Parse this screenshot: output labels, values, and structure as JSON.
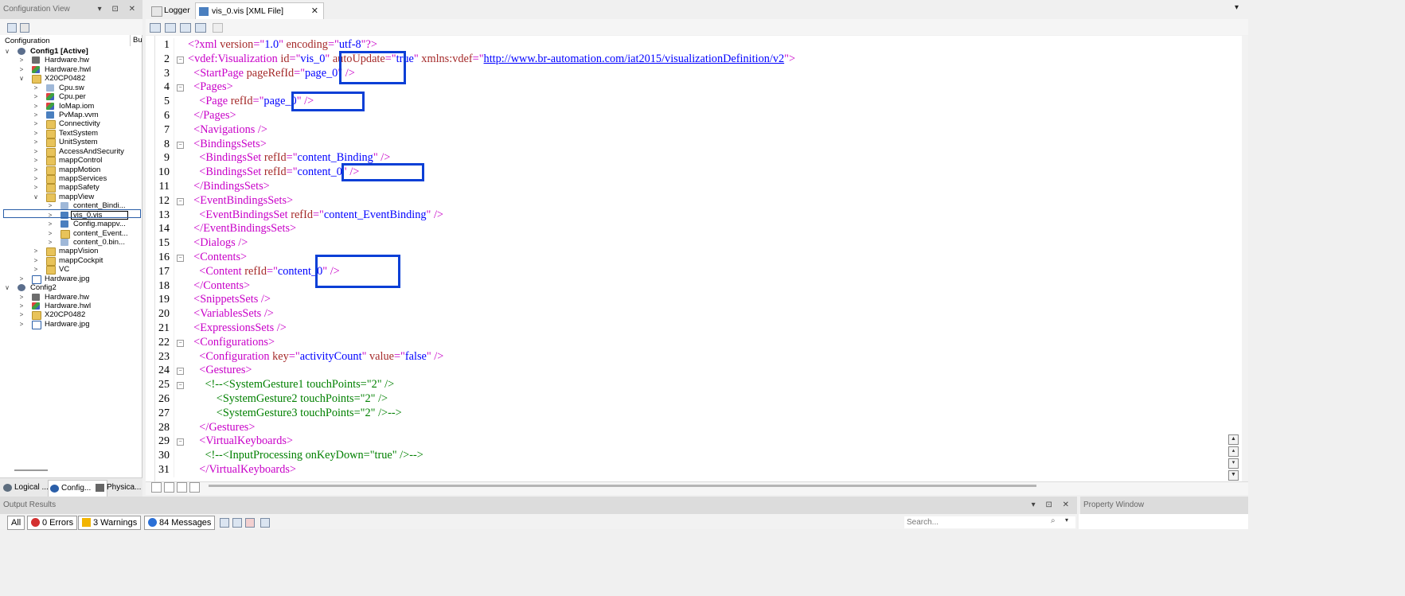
{
  "left_panel": {
    "title": "Configuration View",
    "title_buttons": "▾ ⊡ ✕",
    "column_header": "Configuration",
    "column_header_2": "Bu",
    "tree": [
      {
        "label": "Config1 [Active]",
        "bold": true,
        "indent": 0,
        "chev": "∨",
        "icon": "gear"
      },
      {
        "label": "Hardware.hw",
        "indent": 1,
        "chev": ">",
        "icon": "hw"
      },
      {
        "label": "Hardware.hwl",
        "indent": 1,
        "chev": ">",
        "icon": "multi"
      },
      {
        "label": "X20CP0482",
        "indent": 1,
        "chev": "∨",
        "icon": "folder"
      },
      {
        "label": "Cpu.sw",
        "indent": 2,
        "chev": ">",
        "icon": "doc"
      },
      {
        "label": "Cpu.per",
        "indent": 2,
        "chev": ">",
        "icon": "multi"
      },
      {
        "label": "IoMap.iom",
        "indent": 2,
        "chev": ">",
        "icon": "multi"
      },
      {
        "label": "PvMap.vvm",
        "indent": 2,
        "chev": ">",
        "icon": "cpu"
      },
      {
        "label": "Connectivity",
        "indent": 2,
        "chev": ">",
        "icon": "folder"
      },
      {
        "label": "TextSystem",
        "indent": 2,
        "chev": ">",
        "icon": "folder"
      },
      {
        "label": "UnitSystem",
        "indent": 2,
        "chev": ">",
        "icon": "folder"
      },
      {
        "label": "AccessAndSecurity",
        "indent": 2,
        "chev": ">",
        "icon": "folder"
      },
      {
        "label": "mappControl",
        "indent": 2,
        "chev": ">",
        "icon": "folder"
      },
      {
        "label": "mappMotion",
        "indent": 2,
        "chev": ">",
        "icon": "folder"
      },
      {
        "label": "mappServices",
        "indent": 2,
        "chev": ">",
        "icon": "folder"
      },
      {
        "label": "mappSafety",
        "indent": 2,
        "chev": ">",
        "icon": "folder"
      },
      {
        "label": "mappView",
        "indent": 2,
        "chev": "∨",
        "icon": "folder"
      },
      {
        "label": "content_Bindi...",
        "indent": 3,
        "chev": ">",
        "icon": "doc"
      },
      {
        "label": "vis_0.vis",
        "indent": 3,
        "chev": ">",
        "icon": "cpu",
        "editing": true
      },
      {
        "label": "Config.mappv...",
        "indent": 3,
        "chev": ">",
        "icon": "cpu"
      },
      {
        "label": "content_Event...",
        "indent": 3,
        "chev": ">",
        "icon": "folder"
      },
      {
        "label": "content_0.bin...",
        "indent": 3,
        "chev": ">",
        "icon": "doc"
      },
      {
        "label": "mappVision",
        "indent": 2,
        "chev": ">",
        "icon": "folder"
      },
      {
        "label": "mappCockpit",
        "indent": 2,
        "chev": ">",
        "icon": "folder"
      },
      {
        "label": "VC",
        "indent": 2,
        "chev": ">",
        "icon": "folder"
      },
      {
        "label": "Hardware.jpg",
        "indent": 1,
        "chev": ">",
        "icon": "img"
      },
      {
        "label": "Config2",
        "indent": 0,
        "chev": "∨",
        "icon": "gear"
      },
      {
        "label": "Hardware.hw",
        "indent": 1,
        "chev": ">",
        "icon": "hw"
      },
      {
        "label": "Hardware.hwl",
        "indent": 1,
        "chev": ">",
        "icon": "multi"
      },
      {
        "label": "X20CP0482",
        "indent": 1,
        "chev": ">",
        "icon": "folder"
      },
      {
        "label": "Hardware.jpg",
        "indent": 1,
        "chev": ">",
        "icon": "img"
      }
    ],
    "tabs": [
      "Logical ...",
      "Config...",
      "Physica..."
    ]
  },
  "tabs": {
    "logger": "Logger",
    "active": "vis_0.vis [XML File]",
    "close": "✕",
    "menu": "▾"
  },
  "editor": {
    "line_numbers": [
      "1",
      "2",
      "3",
      "4",
      "5",
      "6",
      "7",
      "8",
      "9",
      "10",
      "11",
      "12",
      "13",
      "14",
      "15",
      "16",
      "17",
      "18",
      "19",
      "20",
      "21",
      "22",
      "23",
      "24",
      "25",
      "26",
      "27",
      "28",
      "29",
      "30",
      "31"
    ],
    "lines": [
      [
        [
          "tag",
          "<?xml "
        ],
        [
          "attr",
          "version"
        ],
        [
          "tag",
          "=\""
        ],
        [
          "val",
          "1.0"
        ],
        [
          "tag",
          "\" "
        ],
        [
          "attr",
          "encoding"
        ],
        [
          "tag",
          "=\""
        ],
        [
          "val",
          "utf-8"
        ],
        [
          "tag",
          "\"?>"
        ]
      ],
      [
        [
          "tag",
          "<vdef:Visualization "
        ],
        [
          "attr",
          "id"
        ],
        [
          "tag",
          "=\""
        ],
        [
          "val",
          "vis_0"
        ],
        [
          "tag",
          "\" "
        ],
        [
          "attr",
          "autoUpdate"
        ],
        [
          "tag",
          "=\""
        ],
        [
          "val",
          "true"
        ],
        [
          "tag",
          "\" "
        ],
        [
          "attr",
          "xmlns:vdef"
        ],
        [
          "tag",
          "=\""
        ],
        [
          "url",
          "http://www.br-automation.com/iat2015/visualizationDefinition/v2"
        ],
        [
          "tag",
          "\">"
        ]
      ],
      [
        [
          "plain",
          "  "
        ],
        [
          "tag",
          "<StartPage "
        ],
        [
          "attr",
          "pageRefId"
        ],
        [
          "tag",
          "=\""
        ],
        [
          "val",
          "page_0"
        ],
        [
          "tag",
          "\" />"
        ]
      ],
      [
        [
          "plain",
          "  "
        ],
        [
          "tag",
          "<Pages>"
        ]
      ],
      [
        [
          "plain",
          "    "
        ],
        [
          "tag",
          "<Page "
        ],
        [
          "attr",
          "refId"
        ],
        [
          "tag",
          "=\""
        ],
        [
          "val",
          "page_0"
        ],
        [
          "tag",
          "\" />"
        ]
      ],
      [
        [
          "plain",
          "  "
        ],
        [
          "tag",
          "</Pages>"
        ]
      ],
      [
        [
          "plain",
          "  "
        ],
        [
          "tag",
          "<Navigations />"
        ]
      ],
      [
        [
          "plain",
          "  "
        ],
        [
          "tag",
          "<BindingsSets>"
        ]
      ],
      [
        [
          "plain",
          "    "
        ],
        [
          "tag",
          "<BindingsSet "
        ],
        [
          "attr",
          "refId"
        ],
        [
          "tag",
          "=\""
        ],
        [
          "val",
          "content_Binding"
        ],
        [
          "tag",
          "\" />"
        ]
      ],
      [
        [
          "plain",
          "    "
        ],
        [
          "tag",
          "<BindingsSet "
        ],
        [
          "attr",
          "refId"
        ],
        [
          "tag",
          "=\""
        ],
        [
          "val",
          "content_0"
        ],
        [
          "tag",
          "\" />"
        ]
      ],
      [
        [
          "plain",
          "  "
        ],
        [
          "tag",
          "</BindingsSets>"
        ]
      ],
      [
        [
          "plain",
          "  "
        ],
        [
          "tag",
          "<EventBindingsSets>"
        ]
      ],
      [
        [
          "plain",
          "    "
        ],
        [
          "tag",
          "<EventBindingsSet "
        ],
        [
          "attr",
          "refId"
        ],
        [
          "tag",
          "=\""
        ],
        [
          "val",
          "content_EventBinding"
        ],
        [
          "tag",
          "\" />"
        ]
      ],
      [
        [
          "plain",
          "  "
        ],
        [
          "tag",
          "</EventBindingsSets>"
        ]
      ],
      [
        [
          "plain",
          "  "
        ],
        [
          "tag",
          "<Dialogs />"
        ]
      ],
      [
        [
          "plain",
          "  "
        ],
        [
          "tag",
          "<Contents>"
        ]
      ],
      [
        [
          "plain",
          "    "
        ],
        [
          "tag",
          "<Content "
        ],
        [
          "attr",
          "refId"
        ],
        [
          "tag",
          "=\""
        ],
        [
          "val",
          "content_0"
        ],
        [
          "tag",
          "\" />"
        ]
      ],
      [
        [
          "plain",
          "  "
        ],
        [
          "tag",
          "</Contents>"
        ]
      ],
      [
        [
          "plain",
          "  "
        ],
        [
          "tag",
          "<SnippetsSets />"
        ]
      ],
      [
        [
          "plain",
          "  "
        ],
        [
          "tag",
          "<VariablesSets />"
        ]
      ],
      [
        [
          "plain",
          "  "
        ],
        [
          "tag",
          "<ExpressionsSets />"
        ]
      ],
      [
        [
          "plain",
          "  "
        ],
        [
          "tag",
          "<Configurations>"
        ]
      ],
      [
        [
          "plain",
          "    "
        ],
        [
          "tag",
          "<Configuration "
        ],
        [
          "attr",
          "key"
        ],
        [
          "tag",
          "=\""
        ],
        [
          "val",
          "activityCount"
        ],
        [
          "tag",
          "\" "
        ],
        [
          "attr",
          "value"
        ],
        [
          "tag",
          "=\""
        ],
        [
          "val",
          "false"
        ],
        [
          "tag",
          "\" />"
        ]
      ],
      [
        [
          "plain",
          "    "
        ],
        [
          "tag",
          "<Gestures>"
        ]
      ],
      [
        [
          "plain",
          "      "
        ],
        [
          "comment",
          "<!--<SystemGesture1 touchPoints=\"2\" />"
        ]
      ],
      [
        [
          "plain",
          "          "
        ],
        [
          "comment",
          "<SystemGesture2 touchPoints=\"2\" />"
        ]
      ],
      [
        [
          "plain",
          "          "
        ],
        [
          "comment",
          "<SystemGesture3 touchPoints=\"2\" />-->"
        ]
      ],
      [
        [
          "plain",
          "    "
        ],
        [
          "tag",
          "</Gestures>"
        ]
      ],
      [
        [
          "plain",
          "    "
        ],
        [
          "tag",
          "<VirtualKeyboards>"
        ]
      ],
      [
        [
          "plain",
          "      "
        ],
        [
          "comment",
          "<!--<InputProcessing onKeyDown=\"true\" />-->"
        ]
      ],
      [
        [
          "plain",
          "    "
        ],
        [
          "tag",
          "</VirtualKeyboards>"
        ]
      ]
    ],
    "fold_lines": [
      2,
      4,
      8,
      12,
      16,
      22,
      24,
      25,
      29
    ],
    "highlight_color": "#0a3fd6"
  },
  "output": {
    "title": "Output Results",
    "title_buttons": "▾ ⊡ ✕",
    "all_label": "All",
    "errors": "0 Errors",
    "warnings": "3 Warnings",
    "messages": "84 Messages",
    "search_placeholder": "Search..."
  },
  "property_window": {
    "title": "Property Window"
  },
  "colors": {
    "tag": "#c800c8",
    "attribute": "#a52a2a",
    "value": "#0000ff",
    "comment": "#008000"
  }
}
